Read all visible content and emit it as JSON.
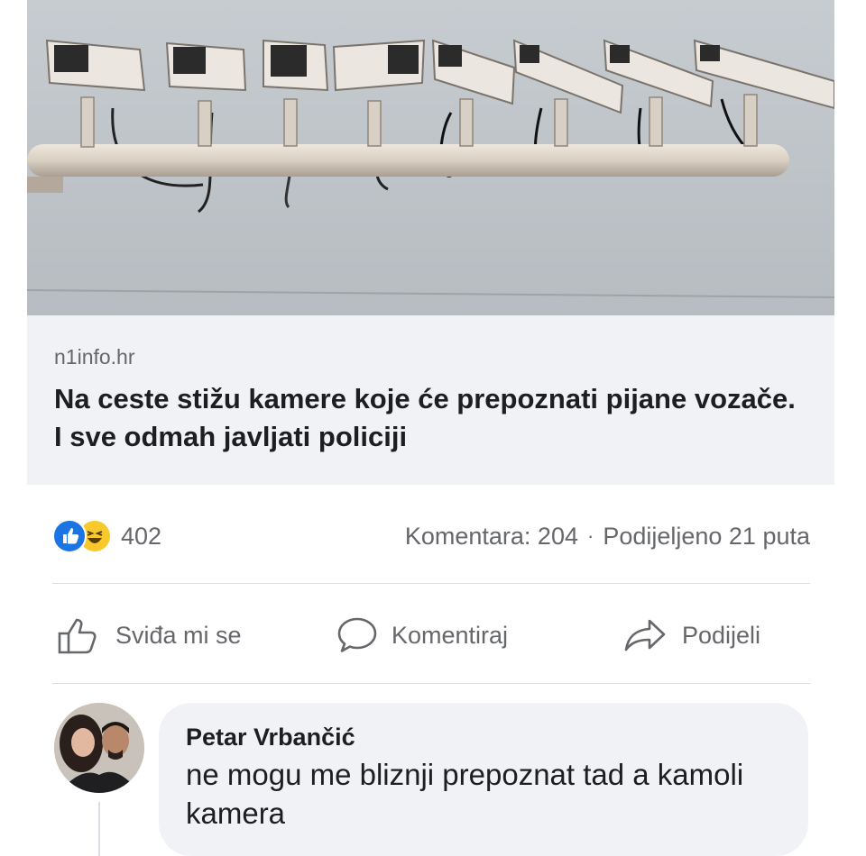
{
  "link_preview": {
    "domain": "n1info.hr",
    "title": "Na ceste stižu kamere koje će prepoznati pijane vozače. I sve odmah javljati policiji"
  },
  "stats": {
    "reaction_icons": [
      "like-icon",
      "haha-icon"
    ],
    "reaction_count": "402",
    "comments": "Komentara: 204",
    "separator": "·",
    "shares": "Podijeljeno 21 puta"
  },
  "actions": {
    "like": "Sviđa mi se",
    "comment": "Komentiraj",
    "share": "Podijeli"
  },
  "comment": {
    "author": "Petar Vrbančić",
    "text": "ne mogu me bliznji prepoznat tad a kamoli kamera"
  },
  "colors": {
    "like_blue": "#1b74e4",
    "haha_yellow": "#f7c92d",
    "secondary_text": "#65676b",
    "card_bg": "#f0f2f5"
  }
}
